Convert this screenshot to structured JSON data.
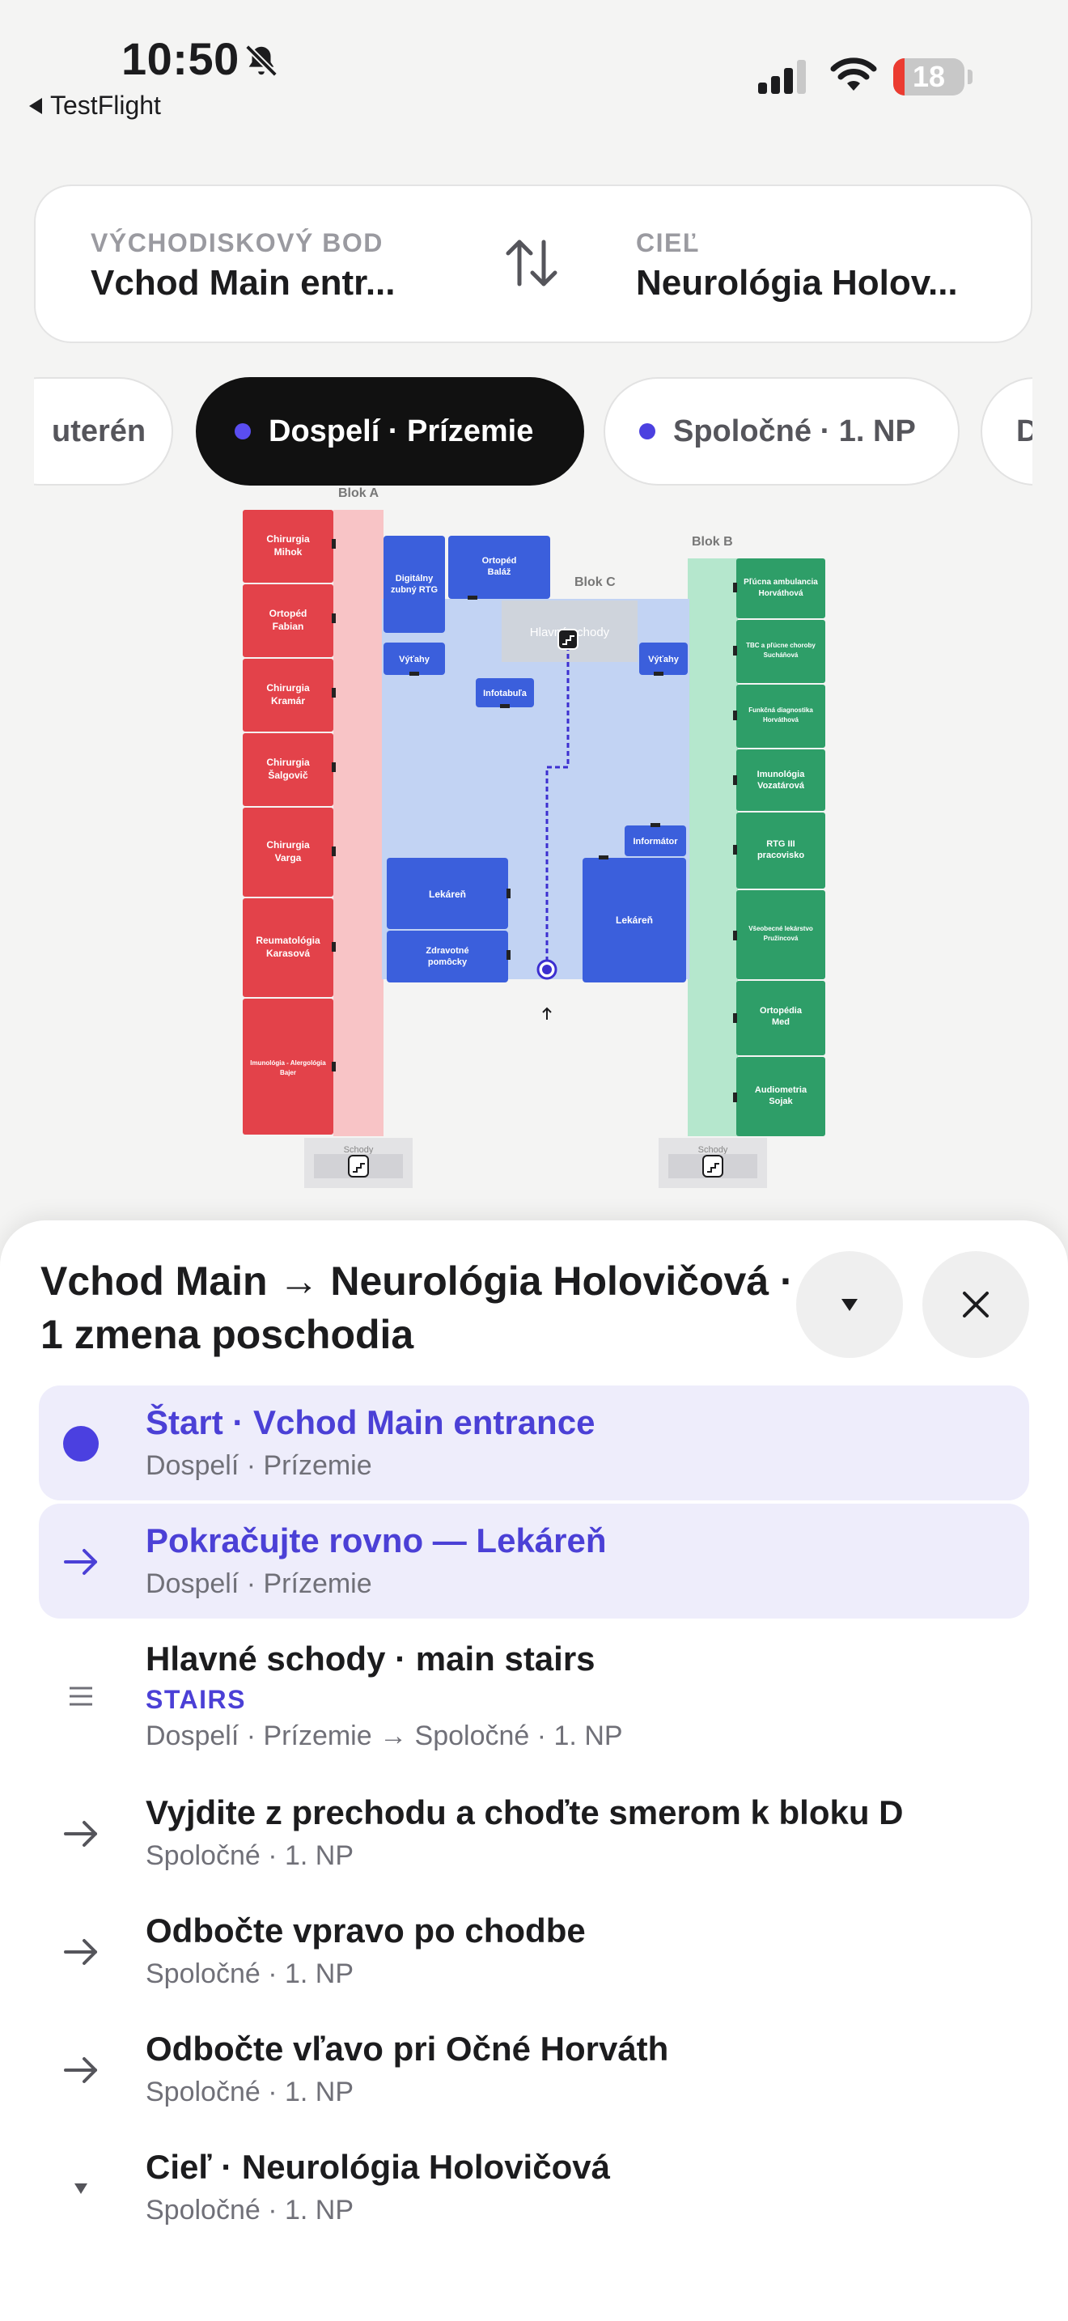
{
  "status_bar": {
    "time": "10:50",
    "back_app": "TestFlight",
    "battery": "18"
  },
  "route": {
    "origin_label": "VÝCHODISKOVÝ BOD",
    "origin_value": "Vchod Main entr...",
    "destination_label": "CIEĽ",
    "destination_value": "Neurológia Holov..."
  },
  "floors": [
    {
      "label": "Suterén",
      "visible_text": "uterén",
      "active": false
    },
    {
      "label": "Dospelí · Prízemie",
      "active": true
    },
    {
      "label": "Spoločné · 1. NP",
      "active": false
    },
    {
      "label": "D",
      "active": false
    }
  ],
  "map": {
    "block_a": "Blok A",
    "block_b": "Blok B",
    "block_c": "Blok C",
    "left_rooms": [
      [
        "Chirurgia",
        "Mihok"
      ],
      [
        "Ortopéd",
        "Fabian"
      ],
      [
        "Chirurgia",
        "Kramár"
      ],
      [
        "Chirurgia",
        "Šalgovič"
      ],
      [
        "Chirurgia",
        "Varga"
      ],
      [
        "Reumatológia",
        "Karasová"
      ],
      [
        "Imunológia - Alergológia",
        "Bajer"
      ]
    ],
    "right_rooms": [
      [
        "Pľúcna ambulancia",
        "Horváthová"
      ],
      [
        "TBC a pľúcne choroby",
        "Sucháňová"
      ],
      [
        "Funkčná diagnostika",
        "Horváthová"
      ],
      [
        "Imunológia",
        "Vozatárová"
      ],
      [
        "RTG III",
        "pracovisko"
      ],
      [
        "Všeobecné lekárstvo",
        "Pružincová"
      ],
      [
        "Ortopédia",
        "Med"
      ],
      [
        "Audiometria",
        "Sojak"
      ]
    ],
    "center_rooms": {
      "dental_rtg": [
        "Digitálny",
        "zubný RTG"
      ],
      "ortoped": [
        "Ortopéd",
        "Baláž"
      ],
      "lifts": "Výťahy",
      "main_stairs": "Hlavné schody",
      "infotabula": "Infotabuľa",
      "informator": "Informátor",
      "pharmacy": "Lekáreň",
      "medical_aids": [
        "Zdravotné",
        "pomôcky"
      ]
    },
    "stairs": "Schody"
  },
  "sheet": {
    "title": "Vchod Main → Neurológia Holovičová · 1 zmena poschodia",
    "steps": [
      {
        "title": "Štart · Vchod Main entrance",
        "subtitle": "Dospelí · Prízemie",
        "icon": "start-dot-icon",
        "highlighted": true
      },
      {
        "title": "Pokračujte rovno — Lekáreň",
        "subtitle": "Dospelí · Prízemie",
        "icon": "arrow-right-icon",
        "highlighted": true
      },
      {
        "title": "Hlavné schody · main stairs",
        "tag": "STAIRS",
        "subtitle": "Dospelí · Prízemie → Spoločné · 1. NP",
        "icon": "stairs-icon",
        "highlighted": false
      },
      {
        "title": "Vyjdite z prechodu a choďte smerom k bloku D",
        "subtitle": "Spoločné · 1. NP",
        "icon": "arrow-right-icon",
        "highlighted": false
      },
      {
        "title": "Odbočte vpravo po chodbe",
        "subtitle": "Spoločné · 1. NP",
        "icon": "arrow-right-icon",
        "highlighted": false
      },
      {
        "title": "Odbočte vľavo pri Očné Horváth",
        "subtitle": "Spoločné · 1. NP",
        "icon": "arrow-right-icon",
        "highlighted": false
      },
      {
        "title": "Cieľ · Neurológia Holovičová",
        "subtitle": "Spoločné · 1. NP",
        "icon": "destination-marker-icon",
        "highlighted": false
      }
    ]
  },
  "colors": {
    "accent": "#4b40d6",
    "left_block": "#e3424a",
    "right_block": "#2e9e68",
    "center_room": "#3b5fdc"
  }
}
